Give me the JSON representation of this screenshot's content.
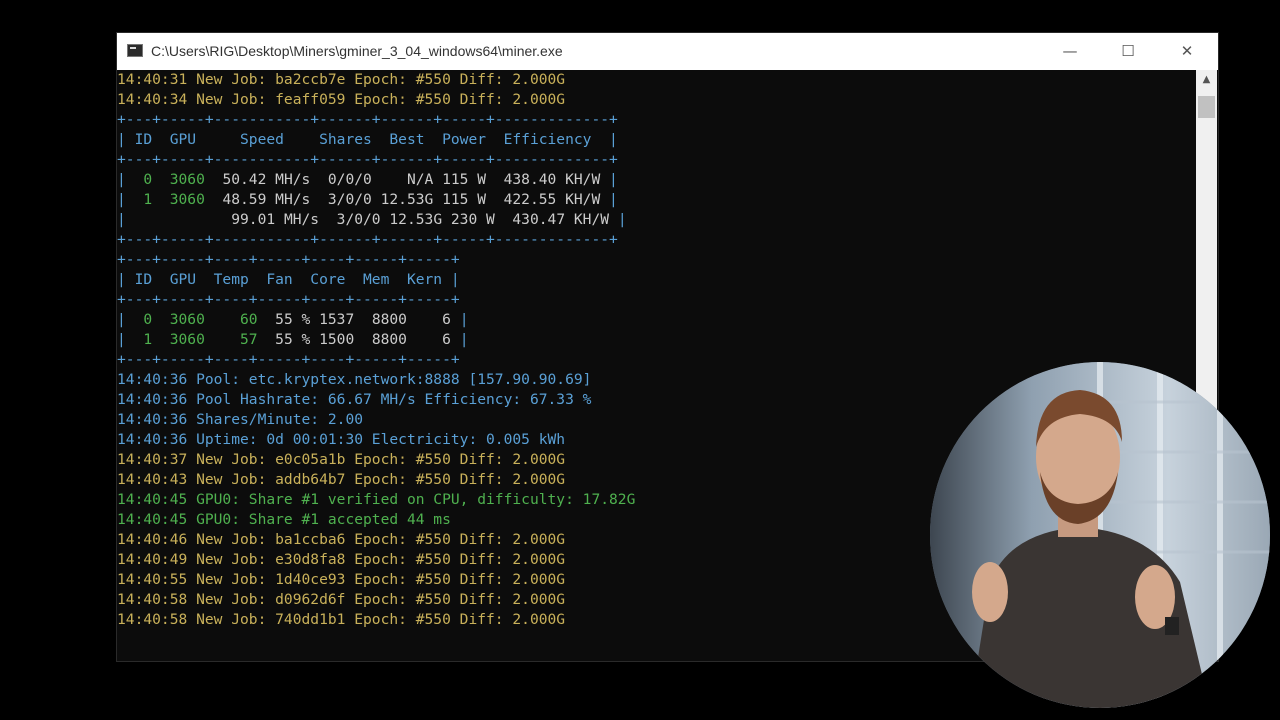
{
  "window": {
    "title": "C:\\Users\\RIG\\Desktop\\Miners\\gminer_3_04_windows64\\miner.exe",
    "controls": {
      "minimize": "—",
      "maximize": "☐",
      "close": "✕"
    }
  },
  "console": {
    "lines": [
      {
        "text": "14:40:31 New Job: ba2ccb7e Epoch: #550 Diff: 2.000G",
        "color": "yellow"
      },
      {
        "text": "14:40:34 New Job: feaff059 Epoch: #550 Diff: 2.000G",
        "color": "yellow"
      },
      {
        "text": "+---+-----+-----------+------+------+-----+-------------+",
        "color": "blue"
      },
      {
        "text": "| ID  GPU     Speed    Shares  Best  Power  Efficiency  |",
        "color": "blue"
      },
      {
        "text": "+---+-----+-----------+------+------+-----+-------------+",
        "color": "blue"
      },
      {
        "segments": [
          {
            "text": "|  ",
            "color": "blue"
          },
          {
            "text": "0  3060",
            "color": "green"
          },
          {
            "text": "  50.42 MH/s  0/0/0    N/A 115 W  438.40 KH/W ",
            "color": "white"
          },
          {
            "text": "|",
            "color": "blue"
          }
        ]
      },
      {
        "segments": [
          {
            "text": "|  ",
            "color": "blue"
          },
          {
            "text": "1  3060",
            "color": "green"
          },
          {
            "text": "  48.59 MH/s  3/0/0 12.53G 115 W  422.55 KH/W ",
            "color": "white"
          },
          {
            "text": "|",
            "color": "blue"
          }
        ]
      },
      {
        "segments": [
          {
            "text": "|",
            "color": "blue"
          },
          {
            "text": "            99.01 MH/s  3/0/0 12.53G 230 W  430.47 KH/W ",
            "color": "white"
          },
          {
            "text": "|",
            "color": "blue"
          }
        ]
      },
      {
        "text": "+---+-----+-----------+------+------+-----+-------------+",
        "color": "blue"
      },
      {
        "text": "+---+-----+----+-----+----+-----+-----+",
        "color": "blue"
      },
      {
        "text": "| ID  GPU  Temp  Fan  Core  Mem  Kern |",
        "color": "blue"
      },
      {
        "text": "+---+-----+----+-----+----+-----+-----+",
        "color": "blue"
      },
      {
        "segments": [
          {
            "text": "|  ",
            "color": "blue"
          },
          {
            "text": "0  3060    60",
            "color": "green"
          },
          {
            "text": "  55 % 1537  8800    6 ",
            "color": "white"
          },
          {
            "text": "|",
            "color": "blue"
          }
        ]
      },
      {
        "segments": [
          {
            "text": "|  ",
            "color": "blue"
          },
          {
            "text": "1  3060    57",
            "color": "green"
          },
          {
            "text": "  55 % 1500  8800    6 ",
            "color": "white"
          },
          {
            "text": "|",
            "color": "blue"
          }
        ]
      },
      {
        "text": "+---+-----+----+-----+----+-----+-----+",
        "color": "blue"
      },
      {
        "text": "14:40:36 Pool: etc.kryptex.network:8888 [157.90.90.69]",
        "color": "blue"
      },
      {
        "text": "14:40:36 Pool Hashrate: 66.67 MH/s Efficiency: 67.33 %",
        "color": "blue"
      },
      {
        "text": "14:40:36 Shares/Minute: 2.00",
        "color": "blue"
      },
      {
        "text": "14:40:36 Uptime: 0d 00:01:30 Electricity: 0.005 kWh",
        "color": "blue"
      },
      {
        "text": "14:40:37 New Job: e0c05a1b Epoch: #550 Diff: 2.000G",
        "color": "yellow"
      },
      {
        "text": "14:40:43 New Job: addb64b7 Epoch: #550 Diff: 2.000G",
        "color": "yellow"
      },
      {
        "text": "14:40:45 GPU0: Share #1 verified on CPU, difficulty: 17.82G",
        "color": "green"
      },
      {
        "text": "14:40:45 GPU0: Share #1 accepted 44 ms",
        "color": "green"
      },
      {
        "text": "14:40:46 New Job: ba1ccba6 Epoch: #550 Diff: 2.000G",
        "color": "yellow"
      },
      {
        "text": "14:40:49 New Job: e30d8fa8 Epoch: #550 Diff: 2.000G",
        "color": "yellow"
      },
      {
        "text": "14:40:55 New Job: 1d40ce93 Epoch: #550 Diff: 2.000G",
        "color": "yellow"
      },
      {
        "text": "14:40:58 New Job: d0962d6f Epoch: #550 Diff: 2.000G",
        "color": "yellow"
      },
      {
        "text": "14:40:58 New Job: 740dd1b1 Epoch: #550 Diff: 2.000G",
        "color": "yellow"
      }
    ]
  },
  "scrollbar": {
    "up_arrow": "▲"
  },
  "colors": {
    "yellow": "#c9b15a",
    "green": "#4fb14f",
    "blue": "#5aa0d6",
    "white": "#cccccc",
    "console_bg": "#0c0c0c"
  }
}
